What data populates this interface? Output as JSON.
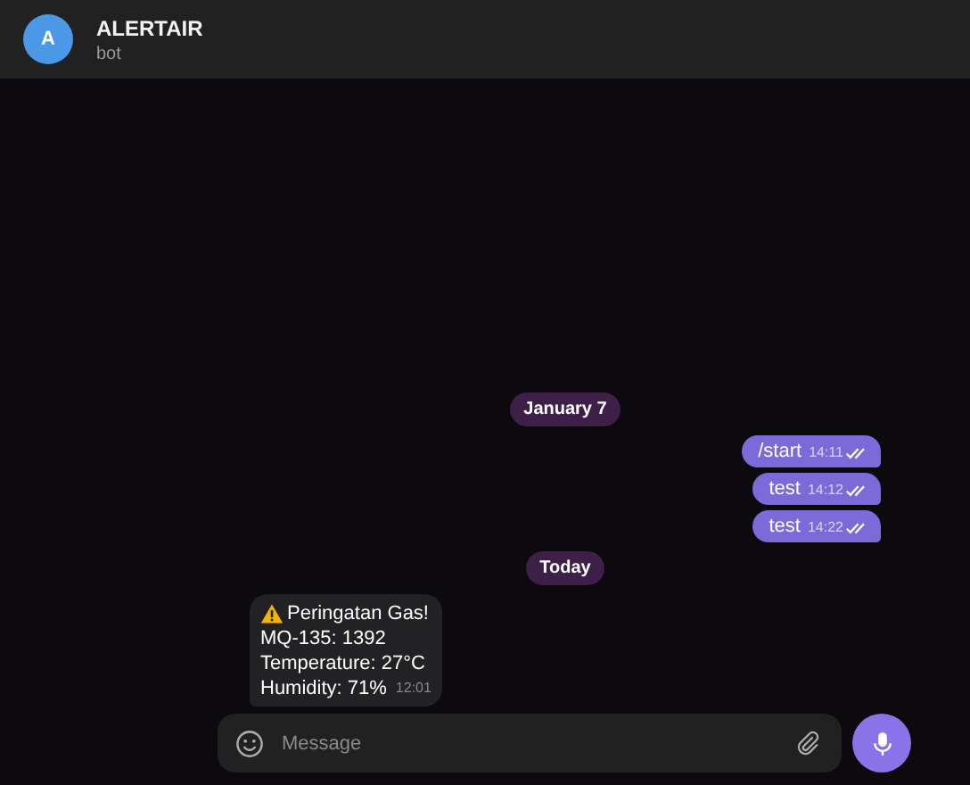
{
  "chat": {
    "title": "ALERTAIR",
    "subtitle": "bot",
    "avatar_letter": "A"
  },
  "messages": [
    {
      "kind": "date",
      "text": "January 7"
    },
    {
      "kind": "outgoing",
      "text": "/start",
      "time": "14:11",
      "read": true
    },
    {
      "kind": "outgoing",
      "text": "test",
      "time": "14:12",
      "read": true
    },
    {
      "kind": "outgoing",
      "text": "test",
      "time": "14:22",
      "read": true
    },
    {
      "kind": "date",
      "text": "Today"
    },
    {
      "kind": "incoming",
      "alert": true,
      "lines": [
        "Peringatan Gas!",
        "MQ-135: 1392",
        "Temperature: 27°C",
        "Humidity: 71%"
      ],
      "time": "12:01"
    }
  ],
  "composer": {
    "placeholder": "Message"
  }
}
